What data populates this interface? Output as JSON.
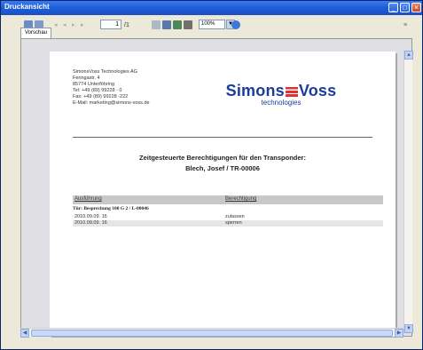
{
  "window": {
    "title": "Druckansicht"
  },
  "toolbar": {
    "page_input": "1",
    "page_total": "/1",
    "zoom": "100%",
    "tab_label": "Vorschau"
  },
  "document": {
    "address": [
      "SimonsVoss Technologies AG",
      "Feringastr. 4",
      "85774 Unterföhring",
      "Tel: +49 (89) 99228 - 0",
      "Fax: +49 (89) 99228 -222",
      "E-Mail: marketing@simons-voss.de"
    ],
    "logo": {
      "brand_left": "Simons",
      "brand_right": "Voss",
      "sub": "technologies"
    },
    "heading_line1": "Zeitgesteuerte Berechtigungen für den Transponder:",
    "heading_line2": "Blech, Josef / TR-00006",
    "table": {
      "col1": "Ausführung",
      "col2": "Berechtigung",
      "group": "Tür:    Besprechung 100 G 2 / L-00046",
      "rows": [
        {
          "time": "2010.09.09. 15",
          "value": "zulassen"
        },
        {
          "time": "2010.09.09. 16",
          "value": "sperren"
        }
      ]
    }
  },
  "colors": {
    "titlebar": "#1f5fd8",
    "logo": "#1a3d9c",
    "logo_accent": "#dd3333"
  }
}
